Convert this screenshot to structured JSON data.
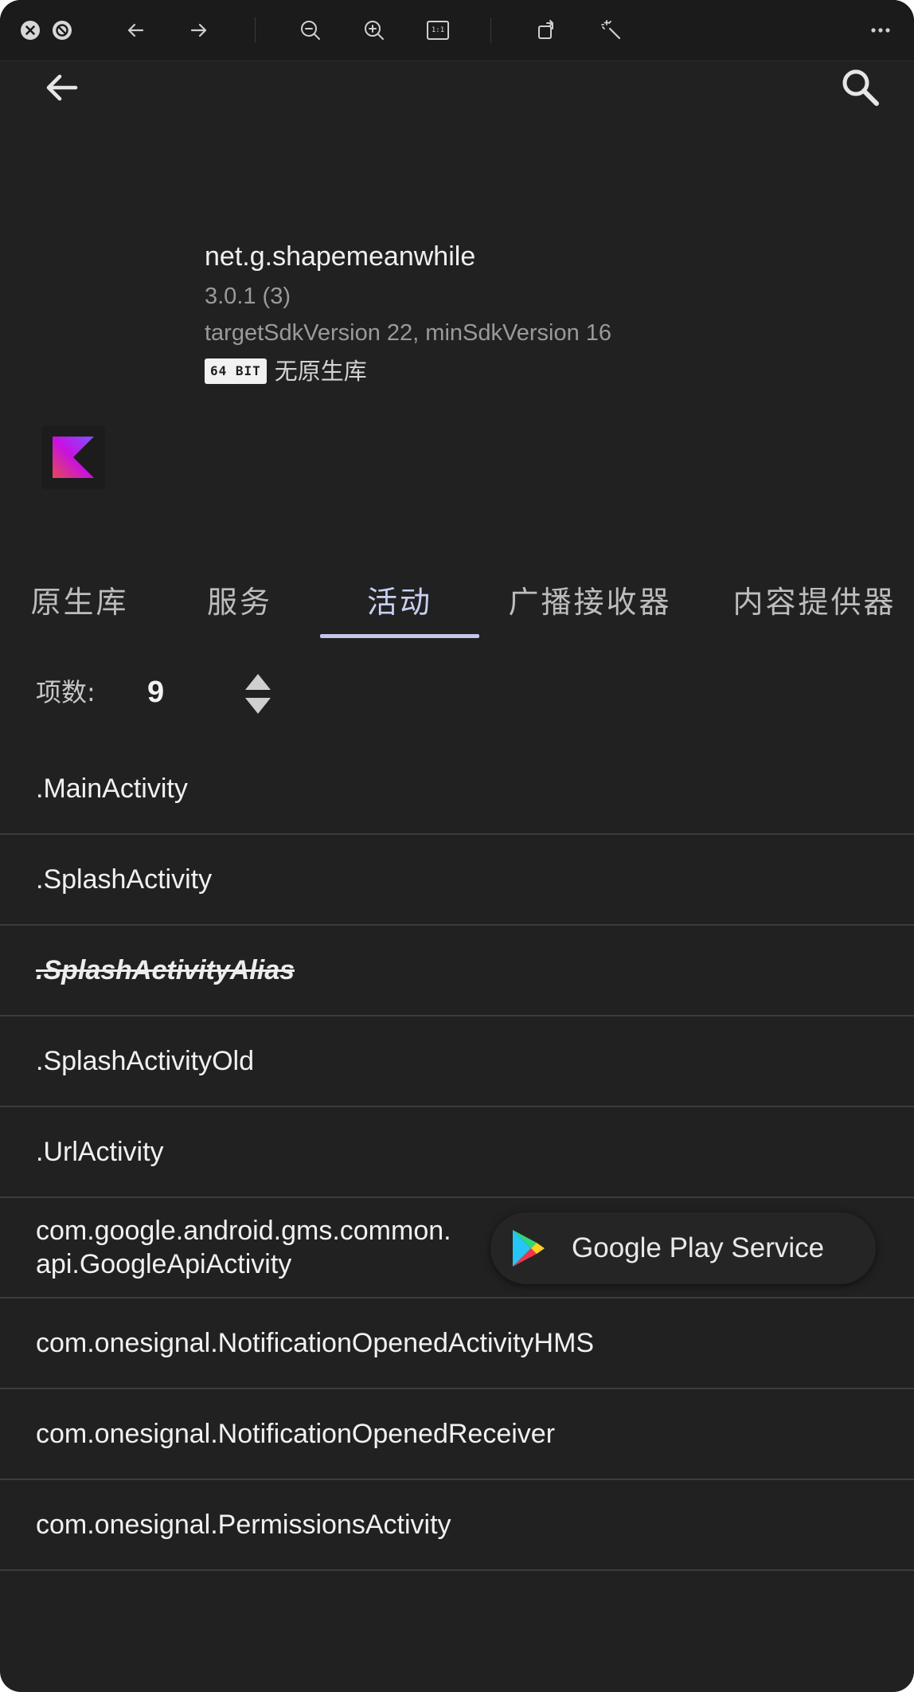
{
  "viewer_toolbar": {
    "close_icon": "close-icon",
    "block_icon": "block-icon",
    "back_icon": "arrow-left-icon",
    "forward_icon": "arrow-right-icon",
    "zoom_out_icon": "zoom-out-icon",
    "zoom_in_icon": "zoom-in-icon",
    "actual_size_label": "1:1",
    "rotate_icon": "rotate-icon",
    "enhance_icon": "magic-wand-icon",
    "more_icon": "more-horizontal-icon"
  },
  "app_bar": {
    "back_icon": "arrow-back-icon",
    "search_icon": "search-icon"
  },
  "app_info": {
    "package_name": "net.g.shapemeanwhile",
    "version": "3.0.1 (3)",
    "sdk": "targetSdkVersion 22, minSdkVersion 16",
    "arch_badge": "64 BIT",
    "native_lib_status": "无原生库",
    "framework_icon": "kotlin-icon"
  },
  "tabs": [
    {
      "label": "原生库",
      "active": false
    },
    {
      "label": "服务",
      "active": false
    },
    {
      "label": "活动",
      "active": true
    },
    {
      "label": "广播接收器",
      "active": false
    },
    {
      "label": "内容提供器",
      "active": false
    }
  ],
  "count": {
    "label": "项数:",
    "value": "9",
    "sort_icon": "sort-icon"
  },
  "activities": [
    {
      "name": ".MainActivity"
    },
    {
      "name": ".SplashActivity"
    },
    {
      "name": ".SplashActivityAlias",
      "disabled": true
    },
    {
      "name": ".SplashActivityOld"
    },
    {
      "name": ".UrlActivity"
    },
    {
      "name": "com.google.android.gms.common.api.GoogleApiActivity",
      "chip_label": "Google Play Service",
      "chip_icon": "google-play-icon"
    },
    {
      "name": "com.onesignal.NotificationOpenedActivityHMS"
    },
    {
      "name": "com.onesignal.NotificationOpenedReceiver"
    },
    {
      "name": "com.onesignal.PermissionsActivity"
    }
  ],
  "colors": {
    "background": "#212121",
    "tab_active": "#c8cff2",
    "divider": "#3c3c3c"
  }
}
